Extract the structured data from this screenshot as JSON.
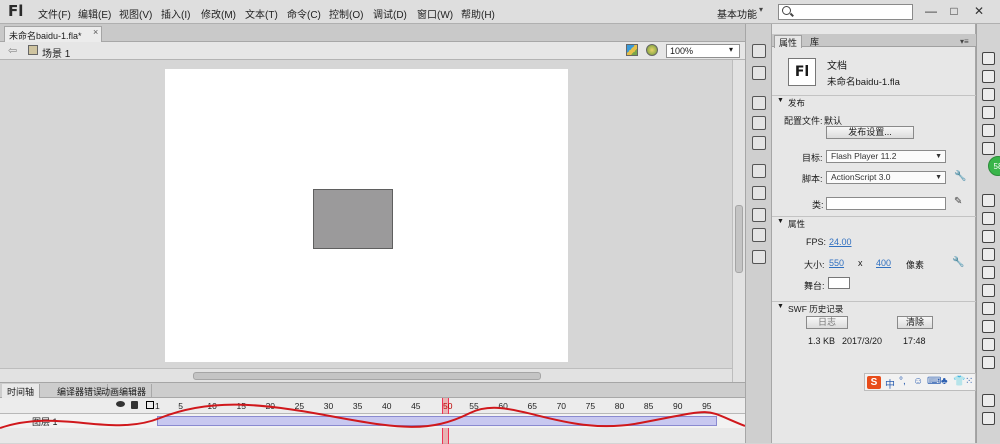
{
  "app": {
    "logo": "Fl"
  },
  "menubar": {
    "items": [
      "文件(F)",
      "编辑(E)",
      "视图(V)",
      "插入(I)",
      "修改(M)",
      "文本(T)",
      "命令(C)",
      "控制(O)",
      "调试(D)",
      "窗口(W)",
      "帮助(H)"
    ],
    "workspace": "基本功能",
    "window_controls": [
      "—",
      "□",
      "✕"
    ]
  },
  "document_tab": {
    "title": "未命名baidu-1.fla*",
    "close": "×"
  },
  "editbar": {
    "scene": "场景 1",
    "zoom": "100%"
  },
  "timeline": {
    "tabs": [
      "时间轴",
      "编译器错误",
      "动画编辑器"
    ],
    "frame_numbers": [
      "1",
      "5",
      "10",
      "15",
      "20",
      "25",
      "30",
      "35",
      "40",
      "45",
      "50",
      "55",
      "60",
      "65",
      "70",
      "75",
      "80",
      "85",
      "90",
      "95"
    ],
    "current_frame": "50",
    "layer_name": "图层 1"
  },
  "properties": {
    "tabs": [
      "属性",
      "库"
    ],
    "doc_icon": "Fl",
    "doc_type": "文档",
    "doc_name": "未命名baidu-1.fla",
    "publish": {
      "header": "发布",
      "profile_label": "配置文件:",
      "profile_value": "默认",
      "settings_button": "发布设置...",
      "target_label": "目标:",
      "target_value": "Flash Player 11.2",
      "script_label": "脚本:",
      "script_value": "ActionScript 3.0",
      "class_label": "类:"
    },
    "props": {
      "header": "属性",
      "fps_label": "FPS:",
      "fps_value": "24.00",
      "size_label": "大小:",
      "width": "550",
      "x_sep": "x",
      "height": "400",
      "unit": "像素",
      "stage_label": "舞台:",
      "stage_color": "#ffffff"
    },
    "swf_history": {
      "header": "SWF 历史记录",
      "log_button": "日志",
      "clear_button": "清除",
      "size": "1.3 KB",
      "date": "2017/3/20",
      "time": "17:48"
    }
  },
  "badge": {
    "text": "58"
  },
  "ime": {
    "logo": "S",
    "glyphs": [
      "中",
      "°,",
      "☺",
      "⌨",
      "♣",
      "👕",
      "⁙"
    ]
  },
  "colors": {
    "stage_rect": "#9b9a9b",
    "frames": "#c8c8f0",
    "playhead": "#e33355"
  }
}
